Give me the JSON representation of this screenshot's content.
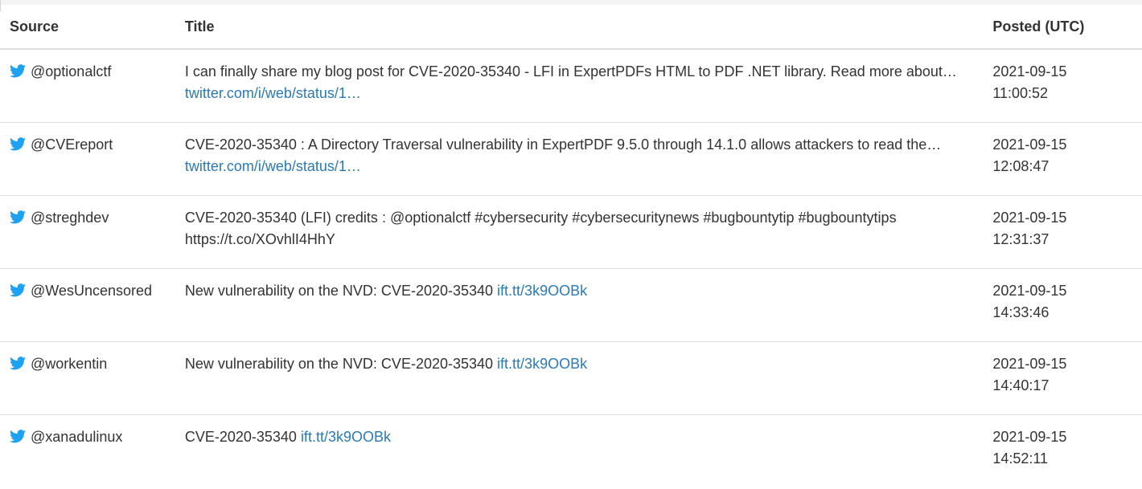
{
  "table": {
    "headers": {
      "source": "Source",
      "title": "Title",
      "posted": "Posted (UTC)"
    },
    "rows": [
      {
        "source": "@optionalctf",
        "text": "I can finally share my blog post for CVE-2020-35340 - LFI in ExpertPDFs HTML to PDF .NET library. Read more about… ",
        "link": "twitter.com/i/web/status/1…",
        "date": "2021-09-15",
        "time": "11:00:52"
      },
      {
        "source": "@CVEreport",
        "text": "CVE-2020-35340 : A Directory Traversal vulnerability in ExpertPDF 9.5.0 through 14.1.0 allows attackers to read the… ",
        "link": "twitter.com/i/web/status/1…",
        "date": "2021-09-15",
        "time": "12:08:47"
      },
      {
        "source": "@streghdev",
        "text": "CVE-2020-35340 (LFI) credits : @optionalctf #cybersecurity #cybersecuritynews #bugbountytip #bugbountytips https://t.co/XOvhlI4HhY",
        "link": "",
        "date": "2021-09-15",
        "time": "12:31:37"
      },
      {
        "source": "@WesUncensored",
        "text": "New vulnerability on the NVD: CVE-2020-35340 ",
        "link": "ift.tt/3k9OOBk",
        "date": "2021-09-15",
        "time": "14:33:46"
      },
      {
        "source": "@workentin",
        "text": "New vulnerability on the NVD: CVE-2020-35340 ",
        "link": "ift.tt/3k9OOBk",
        "date": "2021-09-15",
        "time": "14:40:17"
      },
      {
        "source": "@xanadulinux",
        "text": "CVE-2020-35340 ",
        "link": "ift.tt/3k9OOBk",
        "date": "2021-09-15",
        "time": "14:52:11"
      }
    ]
  },
  "icons": {
    "source_icon": "twitter-bird-icon"
  },
  "colors": {
    "link": "#2a7ab8",
    "twitter": "#1da1f2",
    "text": "#333333",
    "border": "#dddddd"
  }
}
